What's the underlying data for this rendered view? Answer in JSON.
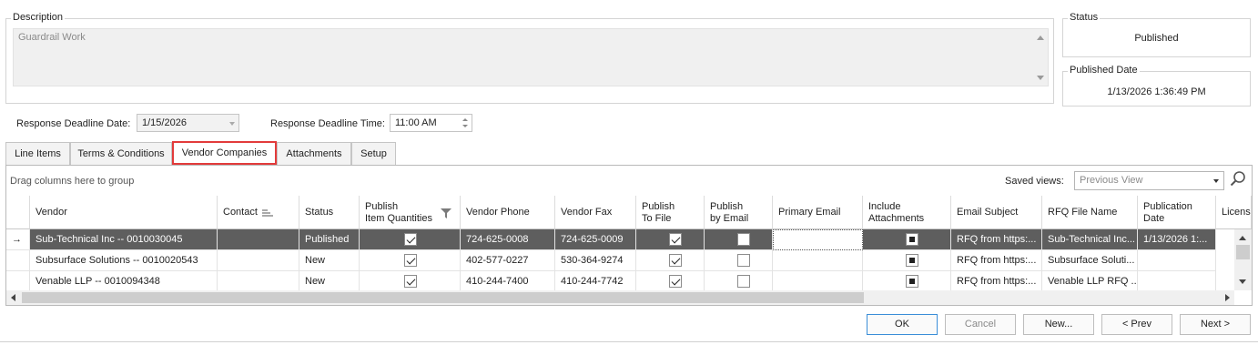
{
  "description": {
    "legend": "Description",
    "value": "Guardrail Work"
  },
  "status": {
    "legend": "Status",
    "value": "Published"
  },
  "published_date": {
    "legend": "Published Date",
    "value": "1/13/2026 1:36:49 PM"
  },
  "deadline": {
    "date_label": "Response Deadline Date:",
    "date_value": "1/15/2026",
    "time_label": "Response Deadline Time:",
    "time_value": "11:00 AM"
  },
  "tabs": [
    {
      "label": "Line Items"
    },
    {
      "label": "Terms & Conditions"
    },
    {
      "label": "Vendor Companies"
    },
    {
      "label": "Attachments"
    },
    {
      "label": "Setup"
    }
  ],
  "grid_toolbar": {
    "group_hint": "Drag columns here to group",
    "saved_views_label": "Saved views:",
    "saved_views_value": "Previous View",
    "search_icon": "search-icon"
  },
  "columns": {
    "vendor": "Vendor",
    "contact": "Contact",
    "status": "Status",
    "publish_qty_1": "Publish",
    "publish_qty_2": "Item Quantities",
    "phone": "Vendor Phone",
    "fax": "Vendor Fax",
    "pub_file_1": "Publish",
    "pub_file_2": "To File",
    "pub_email_1": "Publish",
    "pub_email_2": "by Email",
    "primary_email": "Primary Email",
    "incl_att_1": "Include",
    "incl_att_2": "Attachments",
    "email_subject": "Email Subject",
    "rfq_file": "RFQ File Name",
    "pub_date_1": "Publication",
    "pub_date_2": "Date",
    "license": "License"
  },
  "rows": [
    {
      "vendor": "Sub-Technical Inc -- 0010030045",
      "contact": "",
      "status": "Published",
      "publish_qty": true,
      "phone": "724-625-0008",
      "fax": "724-625-0009",
      "pub_file": true,
      "pub_email": false,
      "primary_email": "",
      "incl_att": true,
      "email_subject": "RFQ from https:...",
      "rfq_file": "Sub-Technical Inc...",
      "pub_date": "1/13/2026 1:..."
    },
    {
      "vendor": "Subsurface Solutions -- 0010020543",
      "contact": "",
      "status": "New",
      "publish_qty": true,
      "phone": "402-577-0227",
      "fax": "530-364-9274",
      "pub_file": true,
      "pub_email": false,
      "primary_email": "",
      "incl_att": true,
      "email_subject": "RFQ from https:...",
      "rfq_file": "Subsurface Soluti...",
      "pub_date": ""
    },
    {
      "vendor": "Venable LLP -- 0010094348",
      "contact": "",
      "status": "New",
      "publish_qty": true,
      "phone": "410-244-7400",
      "fax": "410-244-7742",
      "pub_file": true,
      "pub_email": false,
      "primary_email": "",
      "incl_att": true,
      "email_subject": "RFQ from https:...",
      "rfq_file": "Venable LLP RFQ ...",
      "pub_date": ""
    }
  ],
  "buttons": {
    "ok": "OK",
    "cancel": "Cancel",
    "new": "New...",
    "prev": "< Prev",
    "next": "Next >"
  }
}
